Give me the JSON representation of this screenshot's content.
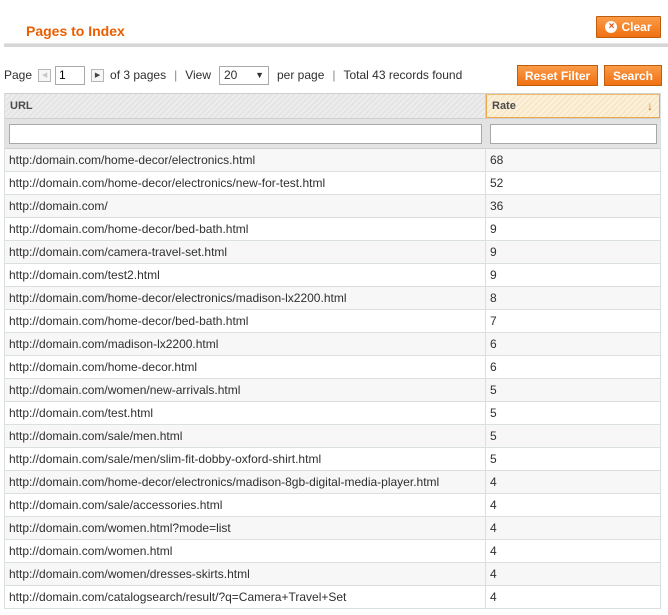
{
  "header": {
    "title": "Pages to Index",
    "clear_label": "Clear"
  },
  "pager": {
    "page_label": "Page",
    "current_page": "1",
    "of_pages": "of 3 pages",
    "view_label": "View",
    "per_page_value": "20",
    "per_page_label": "per page",
    "total_records": "Total 43 records found"
  },
  "actions": {
    "reset_filter": "Reset Filter",
    "search": "Search"
  },
  "grid": {
    "columns": {
      "url": "URL",
      "rate": "Rate"
    },
    "sort": {
      "column": "rate",
      "direction": "desc"
    },
    "rows": [
      {
        "url": "http:/domain.com/home-decor/electronics.html",
        "rate": "68"
      },
      {
        "url": "http://domain.com/home-decor/electronics/new-for-test.html",
        "rate": "52"
      },
      {
        "url": "http://domain.com/",
        "rate": "36"
      },
      {
        "url": "http://domain.com/home-decor/bed-bath.html",
        "rate": "9"
      },
      {
        "url": "http://domain.com/camera-travel-set.html",
        "rate": "9"
      },
      {
        "url": "http://domain.com/test2.html",
        "rate": "9"
      },
      {
        "url": "http://domain.com/home-decor/electronics/madison-lx2200.html",
        "rate": "8"
      },
      {
        "url": "http://domain.com/home-decor/bed-bath.html",
        "rate": "7"
      },
      {
        "url": "http://domain.com/madison-lx2200.html",
        "rate": "6"
      },
      {
        "url": "http://domain.com/home-decor.html",
        "rate": "6"
      },
      {
        "url": "http://domain.com/women/new-arrivals.html",
        "rate": "5"
      },
      {
        "url": "http://domain.com/test.html",
        "rate": "5"
      },
      {
        "url": "http://domain.com/sale/men.html",
        "rate": "5"
      },
      {
        "url": "http://domain.com/sale/men/slim-fit-dobby-oxford-shirt.html",
        "rate": "5"
      },
      {
        "url": "http://domain.com/home-decor/electronics/madison-8gb-digital-media-player.html",
        "rate": "4"
      },
      {
        "url": "http://domain.com/sale/accessories.html",
        "rate": "4"
      },
      {
        "url": "http://domain.com/women.html?mode=list",
        "rate": "4"
      },
      {
        "url": "http://domain.com/women.html",
        "rate": "4"
      },
      {
        "url": "http://domain.com/women/dresses-skirts.html",
        "rate": "4"
      },
      {
        "url": "http://domain.com/catalogsearch/result/?q=Camera+Travel+Set",
        "rate": "4"
      }
    ]
  },
  "icons": {
    "clear": "close-circle-icon",
    "prev": "arrow-left-icon",
    "next": "arrow-right-icon",
    "select": "chevron-down-icon",
    "sort": "sort-desc-arrow-icon"
  },
  "colors": {
    "accent": "#eb5e00",
    "button": "#f07012",
    "sorted_header": "#fbf1dc"
  }
}
